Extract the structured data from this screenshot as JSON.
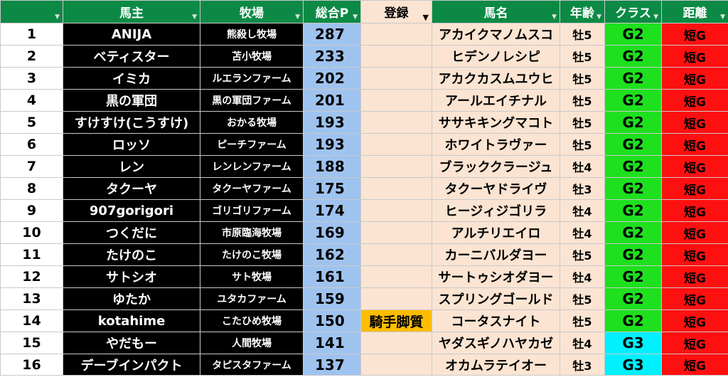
{
  "headers": {
    "col0": "",
    "owner": "馬主",
    "farm": "牧場",
    "points": "総合P",
    "registration": "登録",
    "horse": "馬名",
    "age": "年齢",
    "class": "クラス",
    "distance": "距離"
  },
  "colors": {
    "header_bg": "#0c8a45",
    "owner_bg": "#000000",
    "points_bg": "#9fc3ef",
    "horse_bg": "#fbe4d2",
    "registration_highlight": "#ffbd00",
    "class_g2": "#1ee01e",
    "class_g3": "#00f0ff",
    "distance_bg": "#ff1010"
  },
  "rows": [
    {
      "num": "1",
      "owner": "ANIJA",
      "farm": "熊殺し牧場",
      "points": "287",
      "reg": "",
      "horse": "アカイクマノムスコ",
      "age": "牡5",
      "cls": "G2",
      "dist": "短G"
    },
    {
      "num": "2",
      "owner": "ベティスター",
      "farm": "苫小牧場",
      "points": "233",
      "reg": "",
      "horse": "ヒデンノレシピ",
      "age": "牡5",
      "cls": "G2",
      "dist": "短G"
    },
    {
      "num": "3",
      "owner": "イミカ",
      "farm": "ルエランファーム",
      "points": "202",
      "reg": "",
      "horse": "アカクカスムユウヒ",
      "age": "牡5",
      "cls": "G2",
      "dist": "短G"
    },
    {
      "num": "4",
      "owner": "黒の軍団",
      "farm": "黒の軍団ファーム",
      "points": "201",
      "reg": "",
      "horse": "アールエイチナル",
      "age": "牡5",
      "cls": "G2",
      "dist": "短G"
    },
    {
      "num": "5",
      "owner": "すけすけ(こうすけ)",
      "farm": "おかる牧場",
      "points": "193",
      "reg": "",
      "horse": "ササキキングマコト",
      "age": "牡5",
      "cls": "G2",
      "dist": "短G"
    },
    {
      "num": "6",
      "owner": "ロッソ",
      "farm": "ピーチファーム",
      "points": "193",
      "reg": "",
      "horse": "ホワイトラヴァー",
      "age": "牡5",
      "cls": "G2",
      "dist": "短G"
    },
    {
      "num": "7",
      "owner": "レン",
      "farm": "レンレンファーム",
      "points": "188",
      "reg": "",
      "horse": "ブラッククラージュ",
      "age": "牡4",
      "cls": "G2",
      "dist": "短G"
    },
    {
      "num": "8",
      "owner": "タクーヤ",
      "farm": "タクーヤファーム",
      "points": "175",
      "reg": "",
      "horse": "タクーヤドライヴ",
      "age": "牡3",
      "cls": "G2",
      "dist": "短G"
    },
    {
      "num": "9",
      "owner": "907gorigori",
      "farm": "ゴリゴリファーム",
      "points": "174",
      "reg": "",
      "horse": "ヒージィジゴリラ",
      "age": "牡4",
      "cls": "G2",
      "dist": "短G"
    },
    {
      "num": "10",
      "owner": "つくだに",
      "farm": "市原臨海牧場",
      "points": "169",
      "reg": "",
      "horse": "アルチリエイロ",
      "age": "牡4",
      "cls": "G2",
      "dist": "短G"
    },
    {
      "num": "11",
      "owner": "たけのこ",
      "farm": "たけのこ牧場",
      "points": "162",
      "reg": "",
      "horse": "カーニバルダヨー",
      "age": "牡5",
      "cls": "G2",
      "dist": "短G"
    },
    {
      "num": "12",
      "owner": "サトシオ",
      "farm": "サト牧場",
      "points": "161",
      "reg": "",
      "horse": "サートゥシオダヨー",
      "age": "牡4",
      "cls": "G2",
      "dist": "短G"
    },
    {
      "num": "13",
      "owner": "ゆたか",
      "farm": "ユタカファーム",
      "points": "159",
      "reg": "",
      "horse": "スプリングゴールド",
      "age": "牡5",
      "cls": "G2",
      "dist": "短G"
    },
    {
      "num": "14",
      "owner": "kotahime",
      "farm": "こたひめ牧場",
      "points": "150",
      "reg": "騎手脚質",
      "horse": "コータスナイト",
      "age": "牡5",
      "cls": "G2",
      "dist": "短G"
    },
    {
      "num": "15",
      "owner": "やだもー",
      "farm": "人間牧場",
      "points": "141",
      "reg": "",
      "horse": "ヤダスギノハヤカゼ",
      "age": "牡4",
      "cls": "G3",
      "dist": "短G"
    },
    {
      "num": "16",
      "owner": "デーブインパクト",
      "farm": "タピスタファーム",
      "points": "137",
      "reg": "",
      "horse": "オカムラテイオー",
      "age": "牡3",
      "cls": "G3",
      "dist": "短G"
    }
  ]
}
